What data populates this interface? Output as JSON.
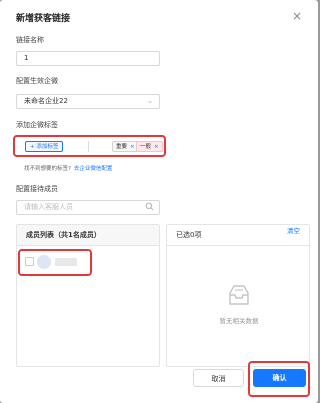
{
  "dialog": {
    "title": "新增获客链接",
    "close_icon": "×"
  },
  "form": {
    "link_name": {
      "label": "链接名称",
      "value": "1"
    },
    "corp": {
      "label": "配置生效企微",
      "value": "未命名企业22"
    },
    "tags": {
      "label": "添加企微标签",
      "add_button": "+ 添加标签",
      "items": [
        {
          "label": "重要",
          "remove": "×"
        },
        {
          "label": "一般",
          "remove": "×"
        }
      ],
      "hint": "找不到想要的标签?",
      "hint_link": "去企业微信配置"
    },
    "reception": {
      "label": "配置接待成员",
      "search_placeholder": "请输入客服人员"
    }
  },
  "member_panel": {
    "title": "成员列表（共1名成员）"
  },
  "selected_panel": {
    "title": "已选0项",
    "clear": "清空",
    "empty_text": "暂无相关数据"
  },
  "footer": {
    "cancel": "取消",
    "confirm": "确认"
  },
  "colors": {
    "primary": "#1677ff",
    "highlight": "#e2383b"
  }
}
